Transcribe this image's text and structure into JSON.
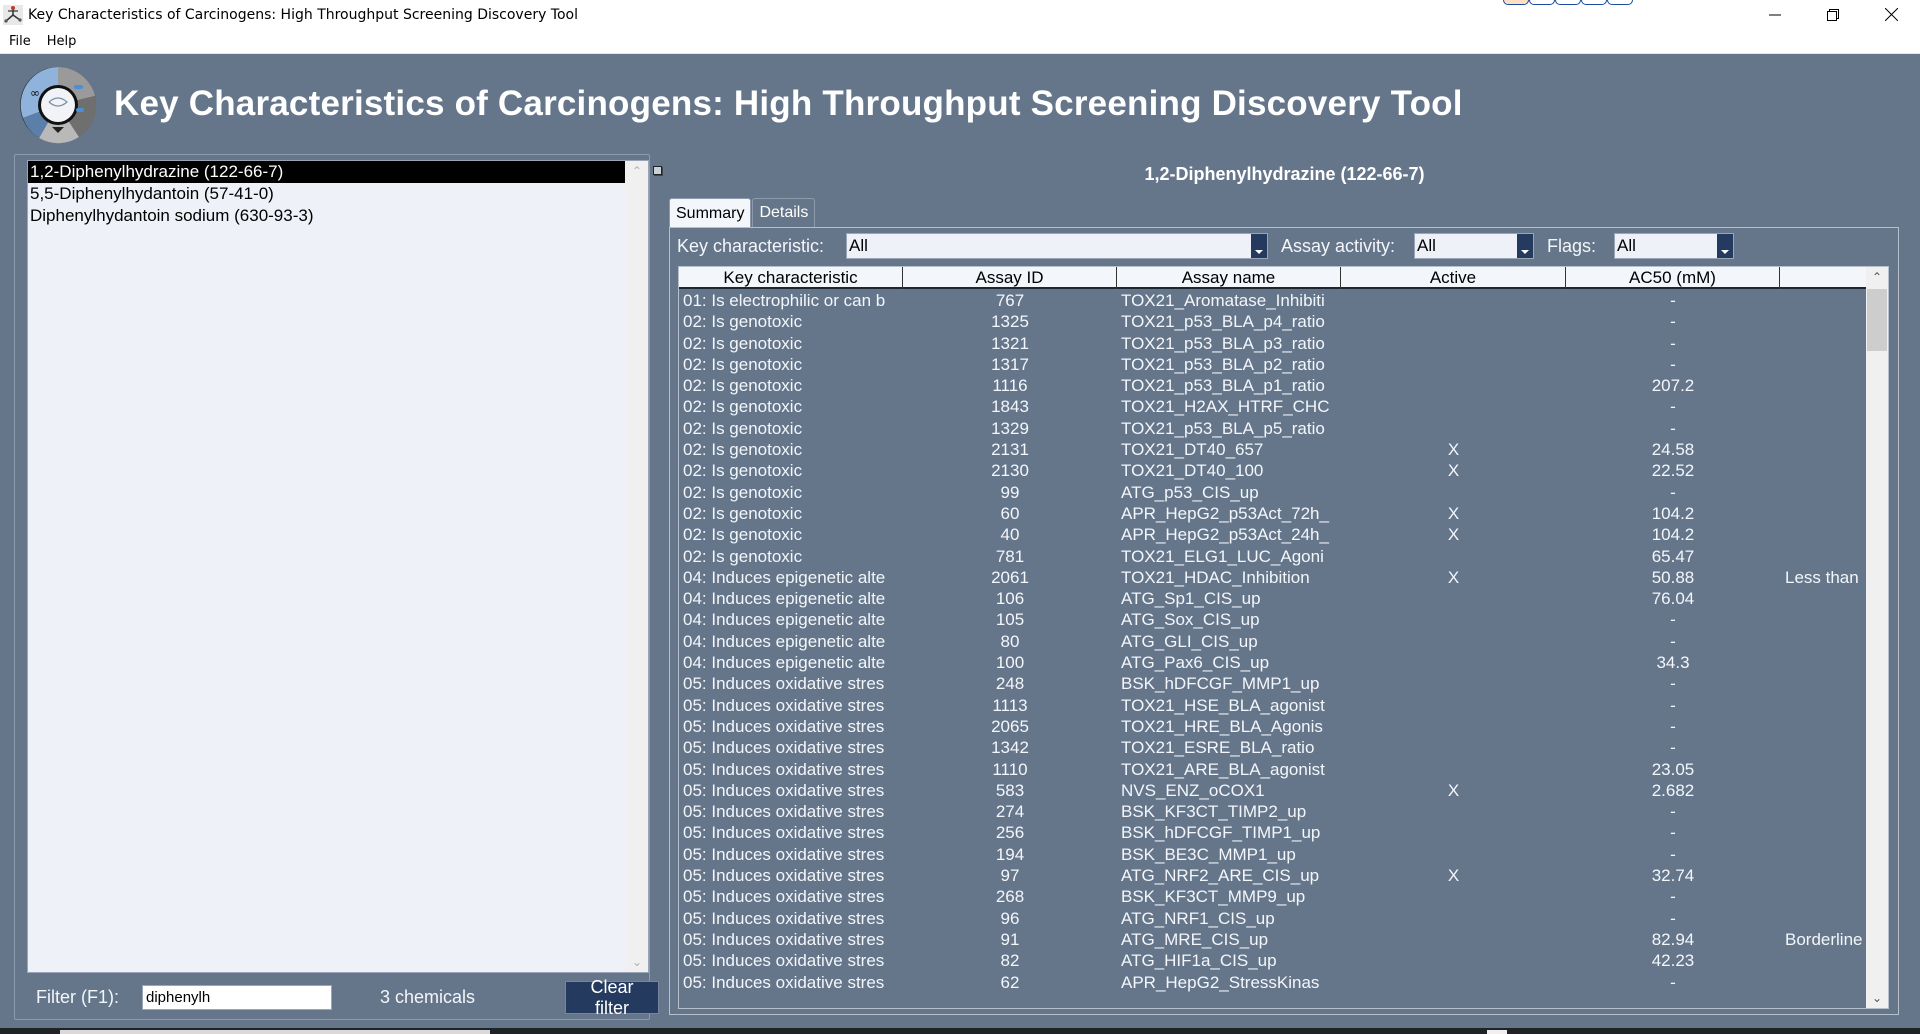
{
  "window": {
    "title": "Key Characteristics of Carcinogens: High Throughput Screening Discovery Tool",
    "controls": {
      "minimize": "—",
      "restore": "❐",
      "close": "✕"
    }
  },
  "menu": {
    "items": [
      "File",
      "Help"
    ]
  },
  "header": {
    "heading": "Key Characteristics of Carcinogens: High Throughput Screening Discovery Tool"
  },
  "chemicals": {
    "items": [
      {
        "label": "1,2-Diphenylhydrazine (122-66-7)",
        "selected": true
      },
      {
        "label": "5,5-Diphenylhydantoin (57-41-0)",
        "selected": false
      },
      {
        "label": "Diphenylhydantoin sodium (630-93-3)",
        "selected": false
      }
    ],
    "filter_label": "Filter (F1):",
    "filter_value": "diphenylh",
    "count_text": "3 chemicals",
    "clear_button": "Clear filter"
  },
  "detail": {
    "title": "1,2-Diphenylhydrazine (122-66-7)",
    "tabs": [
      {
        "label": "Summary",
        "active": true
      },
      {
        "label": "Details",
        "active": false
      }
    ],
    "filters": {
      "key_characteristic": {
        "label": "Key characteristic:",
        "value": "All"
      },
      "assay_activity": {
        "label": "Assay activity:",
        "value": "All"
      },
      "flags": {
        "label": "Flags:",
        "value": "All"
      }
    },
    "table": {
      "columns": [
        "Key characteristic",
        "Assay ID",
        "Assay name",
        "Active",
        "AC50 (mM)",
        ""
      ],
      "rows": [
        [
          "01: Is electrophilic or can b",
          "767",
          "TOX21_Aromatase_Inhibiti",
          "",
          "-",
          ""
        ],
        [
          "02: Is genotoxic",
          "1325",
          "TOX21_p53_BLA_p4_ratio",
          "",
          "-",
          ""
        ],
        [
          "02: Is genotoxic",
          "1321",
          "TOX21_p53_BLA_p3_ratio",
          "",
          "-",
          ""
        ],
        [
          "02: Is genotoxic",
          "1317",
          "TOX21_p53_BLA_p2_ratio",
          "",
          "-",
          ""
        ],
        [
          "02: Is genotoxic",
          "1116",
          "TOX21_p53_BLA_p1_ratio",
          "",
          "207.2",
          ""
        ],
        [
          "02: Is genotoxic",
          "1843",
          "TOX21_H2AX_HTRF_CHC",
          "",
          "-",
          ""
        ],
        [
          "02: Is genotoxic",
          "1329",
          "TOX21_p53_BLA_p5_ratio",
          "",
          "-",
          ""
        ],
        [
          "02: Is genotoxic",
          "2131",
          "TOX21_DT40_657",
          "X",
          "24.58",
          ""
        ],
        [
          "02: Is genotoxic",
          "2130",
          "TOX21_DT40_100",
          "X",
          "22.52",
          ""
        ],
        [
          "02: Is genotoxic",
          "99",
          "ATG_p53_CIS_up",
          "",
          "-",
          ""
        ],
        [
          "02: Is genotoxic",
          "60",
          "APR_HepG2_p53Act_72h_",
          "X",
          "104.2",
          ""
        ],
        [
          "02: Is genotoxic",
          "40",
          "APR_HepG2_p53Act_24h_",
          "X",
          "104.2",
          ""
        ],
        [
          "02: Is genotoxic",
          "781",
          "TOX21_ELG1_LUC_Agoni",
          "",
          "65.47",
          ""
        ],
        [
          "04: Induces epigenetic alte",
          "2061",
          "TOX21_HDAC_Inhibition",
          "X",
          "50.88",
          "Less than"
        ],
        [
          "04: Induces epigenetic alte",
          "106",
          "ATG_Sp1_CIS_up",
          "",
          "76.04",
          ""
        ],
        [
          "04: Induces epigenetic alte",
          "105",
          "ATG_Sox_CIS_up",
          "",
          "-",
          ""
        ],
        [
          "04: Induces epigenetic alte",
          "80",
          "ATG_GLI_CIS_up",
          "",
          "-",
          ""
        ],
        [
          "04: Induces epigenetic alte",
          "100",
          "ATG_Pax6_CIS_up",
          "",
          "34.3",
          ""
        ],
        [
          "05: Induces oxidative stres",
          "248",
          "BSK_hDFCGF_MMP1_up",
          "",
          "-",
          ""
        ],
        [
          "05: Induces oxidative stres",
          "1113",
          "TOX21_HSE_BLA_agonist",
          "",
          "-",
          ""
        ],
        [
          "05: Induces oxidative stres",
          "2065",
          "TOX21_HRE_BLA_Agonis",
          "",
          "-",
          ""
        ],
        [
          "05: Induces oxidative stres",
          "1342",
          "TOX21_ESRE_BLA_ratio",
          "",
          "-",
          ""
        ],
        [
          "05: Induces oxidative stres",
          "1110",
          "TOX21_ARE_BLA_agonist",
          "",
          "23.05",
          ""
        ],
        [
          "05: Induces oxidative stres",
          "583",
          "NVS_ENZ_oCOX1",
          "X",
          "2.682",
          ""
        ],
        [
          "05: Induces oxidative stres",
          "274",
          "BSK_KF3CT_TIMP2_up",
          "",
          "-",
          ""
        ],
        [
          "05: Induces oxidative stres",
          "256",
          "BSK_hDFCGF_TIMP1_up",
          "",
          "-",
          ""
        ],
        [
          "05: Induces oxidative stres",
          "194",
          "BSK_BE3C_MMP1_up",
          "",
          "-",
          ""
        ],
        [
          "05: Induces oxidative stres",
          "97",
          "ATG_NRF2_ARE_CIS_up",
          "X",
          "32.74",
          ""
        ],
        [
          "05: Induces oxidative stres",
          "268",
          "BSK_KF3CT_MMP9_up",
          "",
          "-",
          ""
        ],
        [
          "05: Induces oxidative stres",
          "96",
          "ATG_NRF1_CIS_up",
          "",
          "-",
          ""
        ],
        [
          "05: Induces oxidative stres",
          "91",
          "ATG_MRE_CIS_up",
          "",
          "82.94",
          "Borderline"
        ],
        [
          "05: Induces oxidative stres",
          "82",
          "ATG_HIF1a_CIS_up",
          "",
          "42.23",
          ""
        ],
        [
          "05: Induces oxidative stres",
          "62",
          "APR_HepG2_StressKinas",
          "",
          "-",
          ""
        ]
      ]
    }
  },
  "icons": {
    "scroll_up": "⌃",
    "scroll_down": "⌄"
  }
}
